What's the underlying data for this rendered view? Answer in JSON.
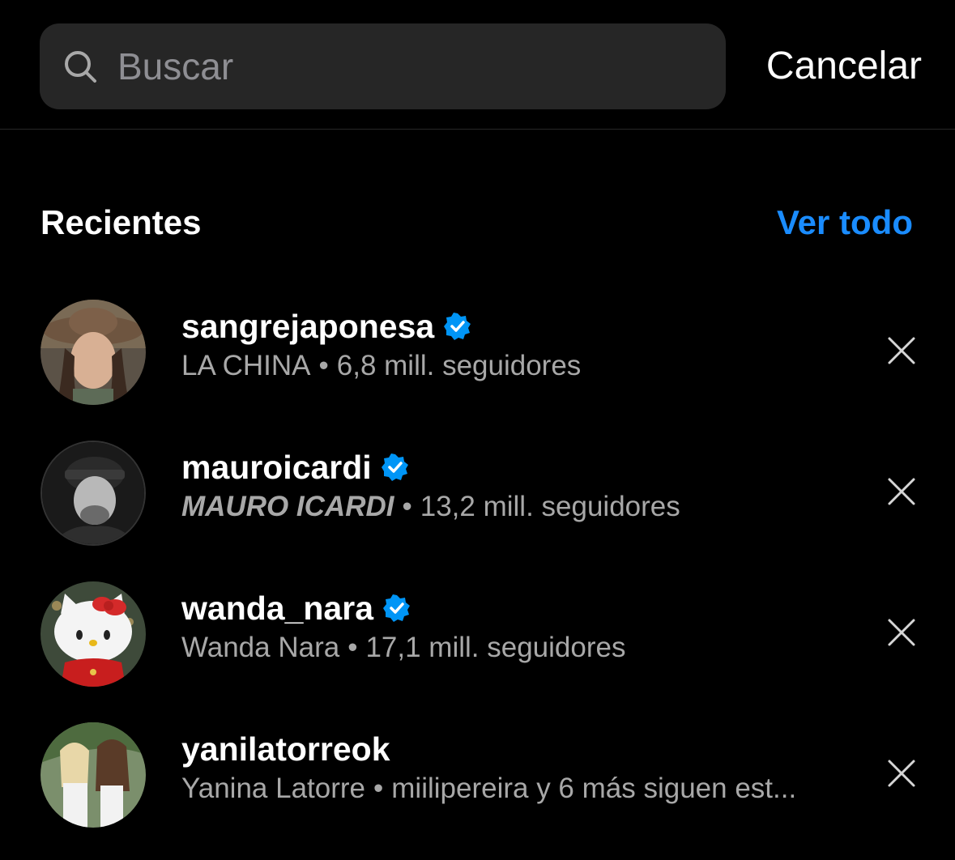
{
  "search": {
    "placeholder": "Buscar",
    "value": "",
    "cancel_label": "Cancelar"
  },
  "recents": {
    "title": "Recientes",
    "see_all_label": "Ver todo",
    "accent_color": "#1a8cff",
    "items": [
      {
        "username": "sangrejaponesa",
        "verified": true,
        "full_name": "LA CHINA",
        "separator": "•",
        "detail": "6,8 mill. seguidores"
      },
      {
        "username": "mauroicardi",
        "verified": true,
        "full_name": "MAURO ICARDI",
        "separator": "•",
        "detail": "13,2 mill. seguidores"
      },
      {
        "username": "wanda_nara",
        "verified": true,
        "full_name": "Wanda Nara",
        "separator": "•",
        "detail": "17,1 mill. seguidores"
      },
      {
        "username": "yanilatorreok",
        "verified": false,
        "full_name": "Yanina Latorre",
        "separator": "•",
        "detail": "miilipereira y 6 más siguen est..."
      }
    ]
  },
  "icons": {
    "search": "search-icon",
    "verified": "verified-badge-icon",
    "remove": "close-icon"
  }
}
